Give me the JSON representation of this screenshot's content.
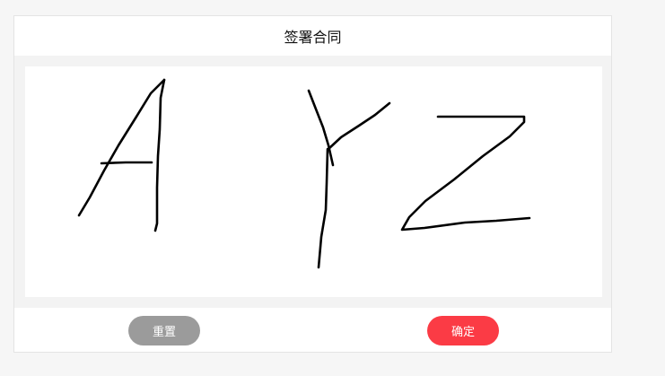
{
  "header": {
    "title": "签署合同"
  },
  "footer": {
    "reset_label": "重置",
    "confirm_label": "确定"
  },
  "colors": {
    "confirm_button": "#fb3b45",
    "reset_button": "#9b9b9b",
    "ink": "#000000"
  }
}
